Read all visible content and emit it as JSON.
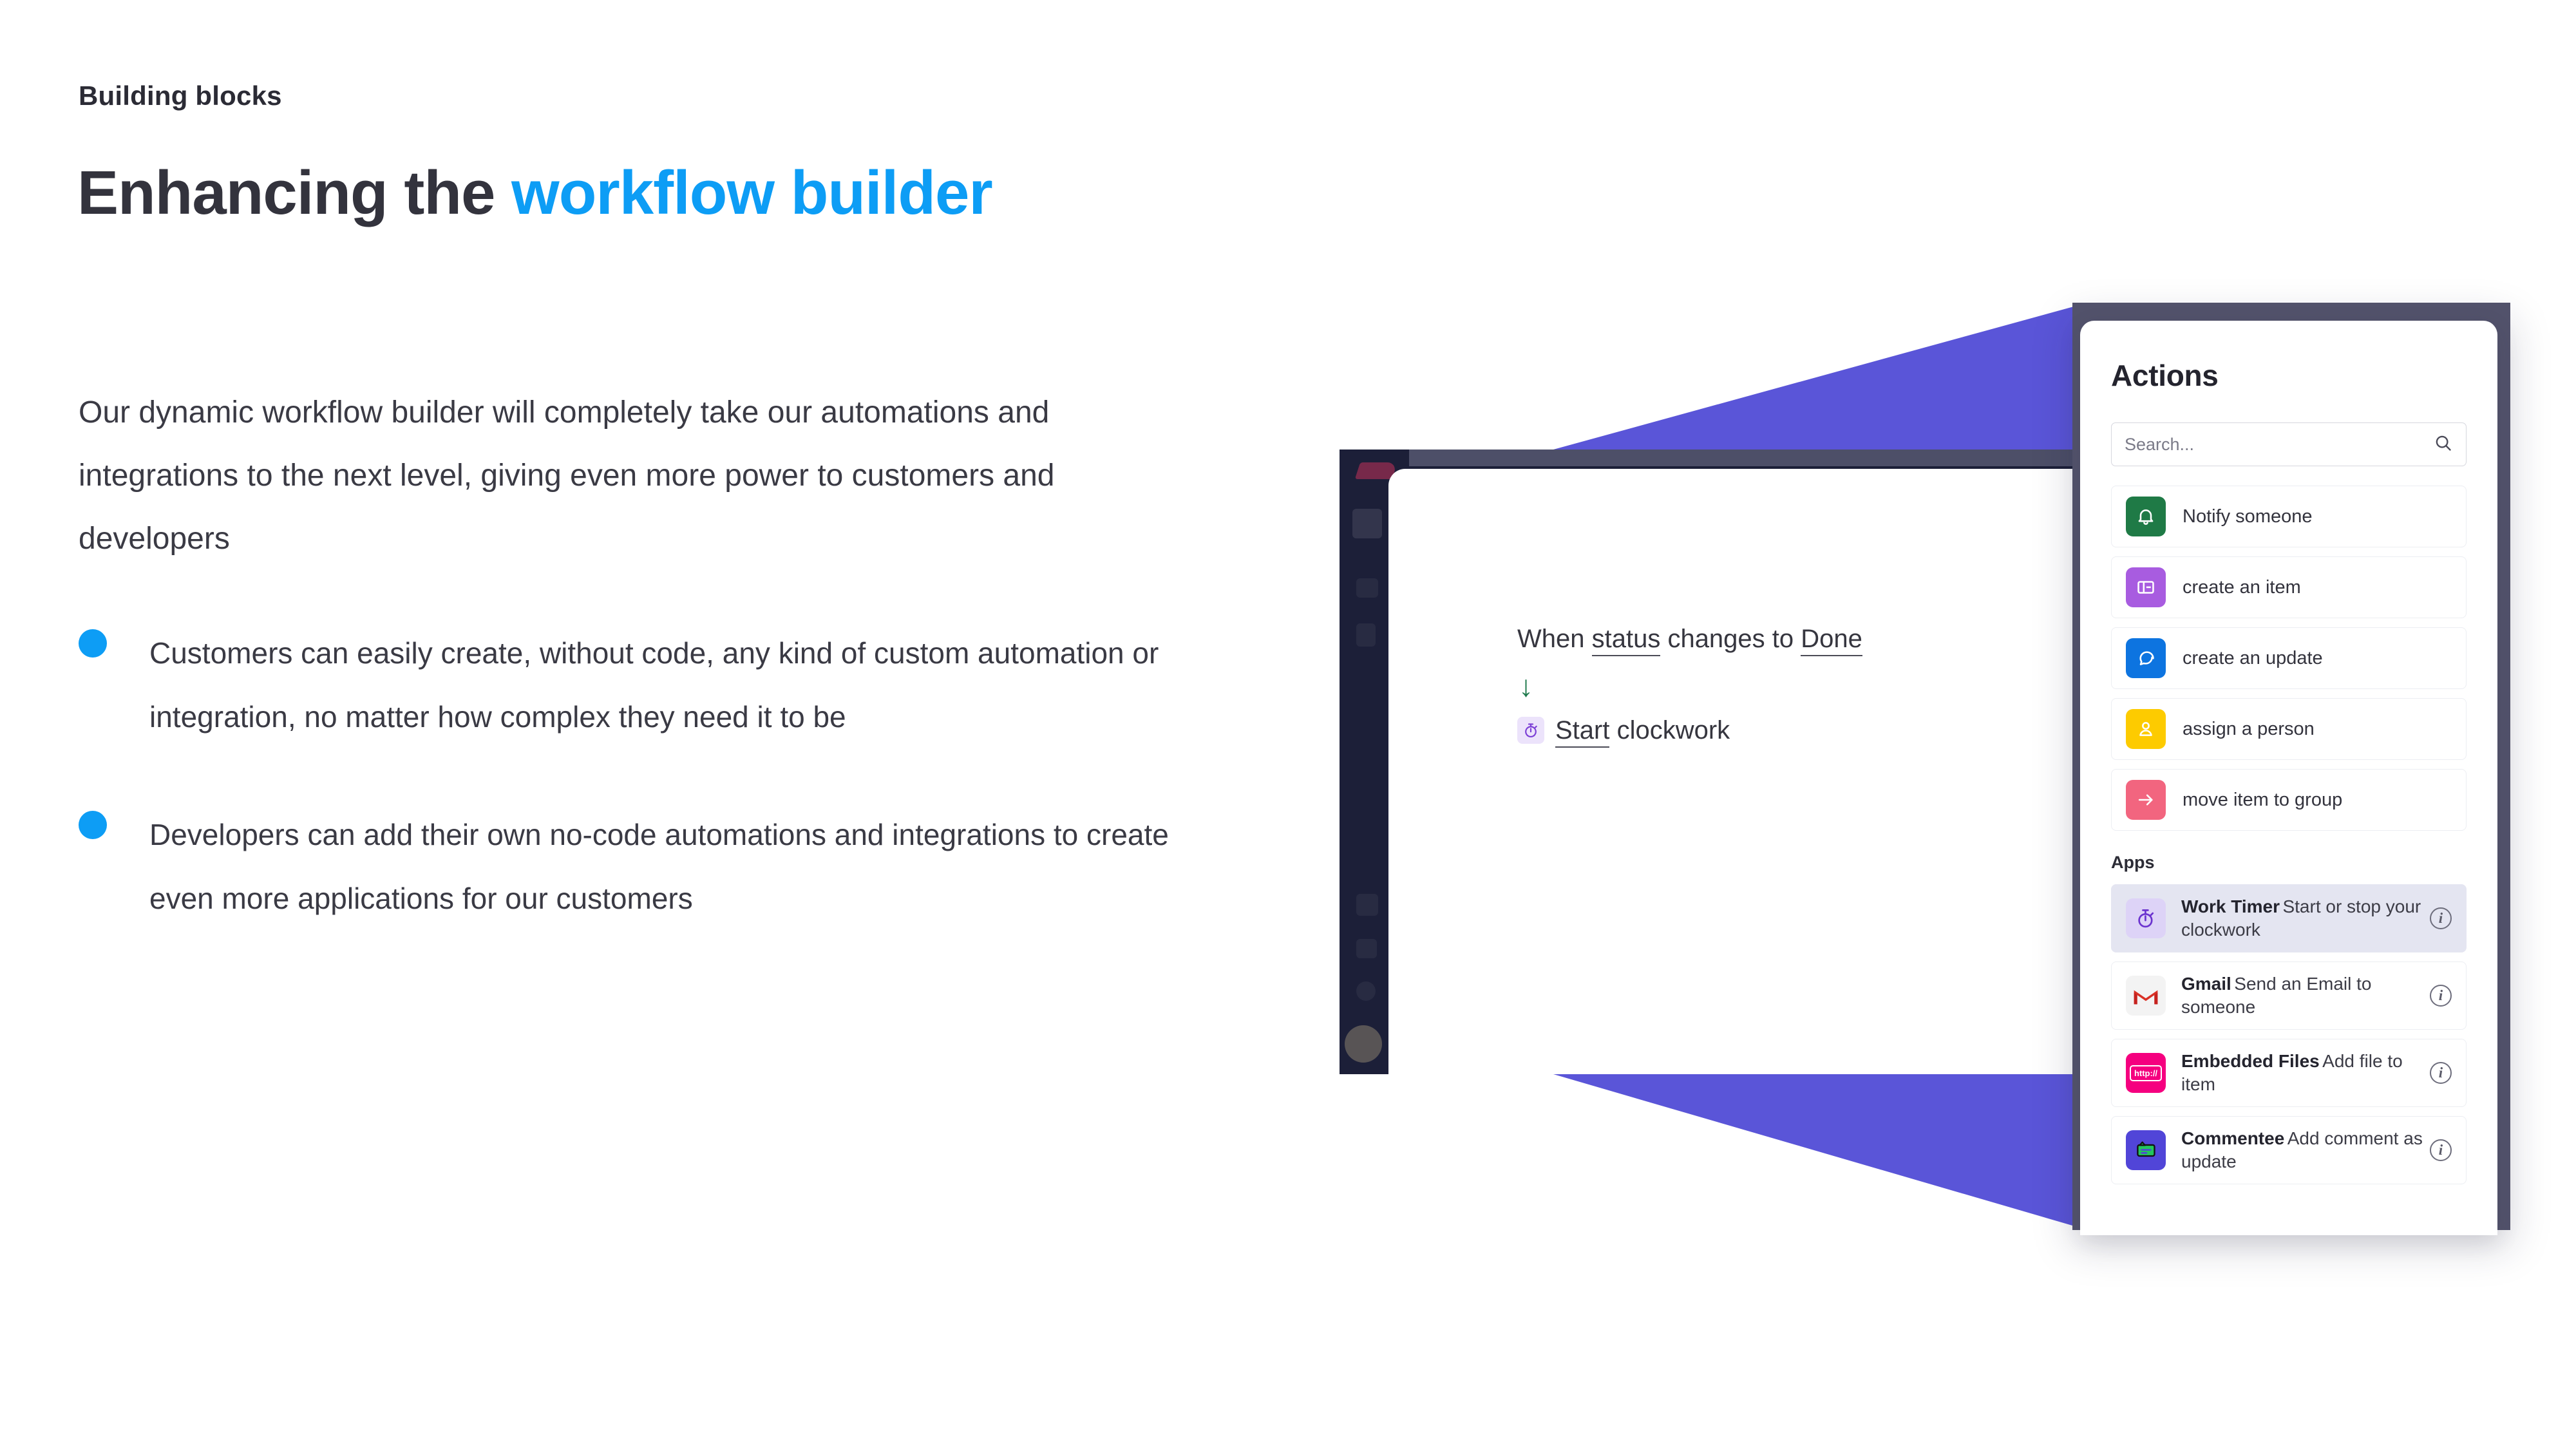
{
  "slide": {
    "eyebrow": "Building blocks",
    "headline_plain": "Enhancing the ",
    "headline_accent": "workflow builder",
    "lede": "Our dynamic workflow builder will completely take our automations and integrations to the next level, giving even more power to customers and developers",
    "bullets": [
      "Customers can easily create, without code, any kind of custom automation or integration, no matter how complex they need it to be",
      "Developers can add their own no-code automations and integrations to create even more applications for our customers"
    ],
    "accent_color": "#0d9df5",
    "text_color": "#3a3a44"
  },
  "board": {
    "recipe": {
      "when_prefix": "When ",
      "trigger_token": "status",
      "when_mid": " changes to ",
      "value_token": "Done",
      "arrow": "↓",
      "action_icon": "stopwatch-icon",
      "action_prefix": "Start",
      "action_suffix": " clockwork"
    }
  },
  "dropdown": {
    "title": "Actions",
    "search": {
      "placeholder": "Search...",
      "value": "",
      "icon": "search-icon"
    },
    "actions": [
      {
        "label": "Notify someone",
        "icon": "bell-icon",
        "color": "#1f7a46"
      },
      {
        "label": "create an item",
        "icon": "board-icon",
        "color": "#a85ce0"
      },
      {
        "label": "create an update",
        "icon": "speech-icon",
        "color": "#0d74e0"
      },
      {
        "label": "assign a person",
        "icon": "person-icon",
        "color": "#fdcb00"
      },
      {
        "label": "move item to group",
        "icon": "arrow-right-icon",
        "color": "#f2657f"
      }
    ],
    "apps_heading": "Apps",
    "apps": [
      {
        "name": "Work Timer",
        "desc": "Start or stop your clockwork",
        "icon": "stopwatch-icon",
        "color": "#ddd3f7",
        "selected": true,
        "info": "ⓘ"
      },
      {
        "name": "Gmail",
        "desc": "Send an Email to someone",
        "icon": "gmail-icon",
        "color": "#f3f3f3",
        "selected": false,
        "info": "ⓘ"
      },
      {
        "name": "Embedded Files",
        "desc": "Add file to item",
        "icon": "http-icon",
        "color": "#f5007f",
        "selected": false,
        "info": "ⓘ"
      },
      {
        "name": "Commentee",
        "desc": "Add comment as update",
        "icon": "comment-badge-icon",
        "color": "#5145d8",
        "selected": false,
        "info": "ⓘ"
      }
    ],
    "frame_color": "#52526b",
    "wedge_color": "#5a55d8",
    "selected_row_color": "#e4e5f1"
  }
}
